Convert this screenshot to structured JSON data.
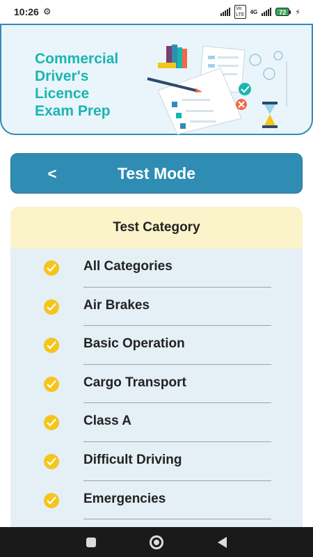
{
  "status_bar": {
    "time": "10:26",
    "network": "4G",
    "battery": "72"
  },
  "banner": {
    "title_lines": [
      "Commercial",
      "Driver's",
      "Licence",
      "Exam Prep"
    ],
    "colors": {
      "title": "#19b6b0",
      "accent": "#2f8db4"
    }
  },
  "header": {
    "back_icon": "chevron-left-icon",
    "title": "Test Mode"
  },
  "category_panel": {
    "title": "Test Category",
    "items": [
      {
        "label": "All Categories",
        "selected": true
      },
      {
        "label": "Air Brakes",
        "selected": true
      },
      {
        "label": "Basic Operation",
        "selected": true
      },
      {
        "label": "Cargo Transport",
        "selected": true
      },
      {
        "label": "Class A",
        "selected": true
      },
      {
        "label": "Difficult Driving",
        "selected": true
      },
      {
        "label": "Emergencies",
        "selected": true
      }
    ],
    "colors": {
      "check": "#f5c51b",
      "head_bg": "#fbf3c9",
      "panel_bg": "#e4eff6"
    }
  },
  "nav_bar": {
    "buttons": [
      "recents-icon",
      "home-icon",
      "back-icon"
    ]
  }
}
